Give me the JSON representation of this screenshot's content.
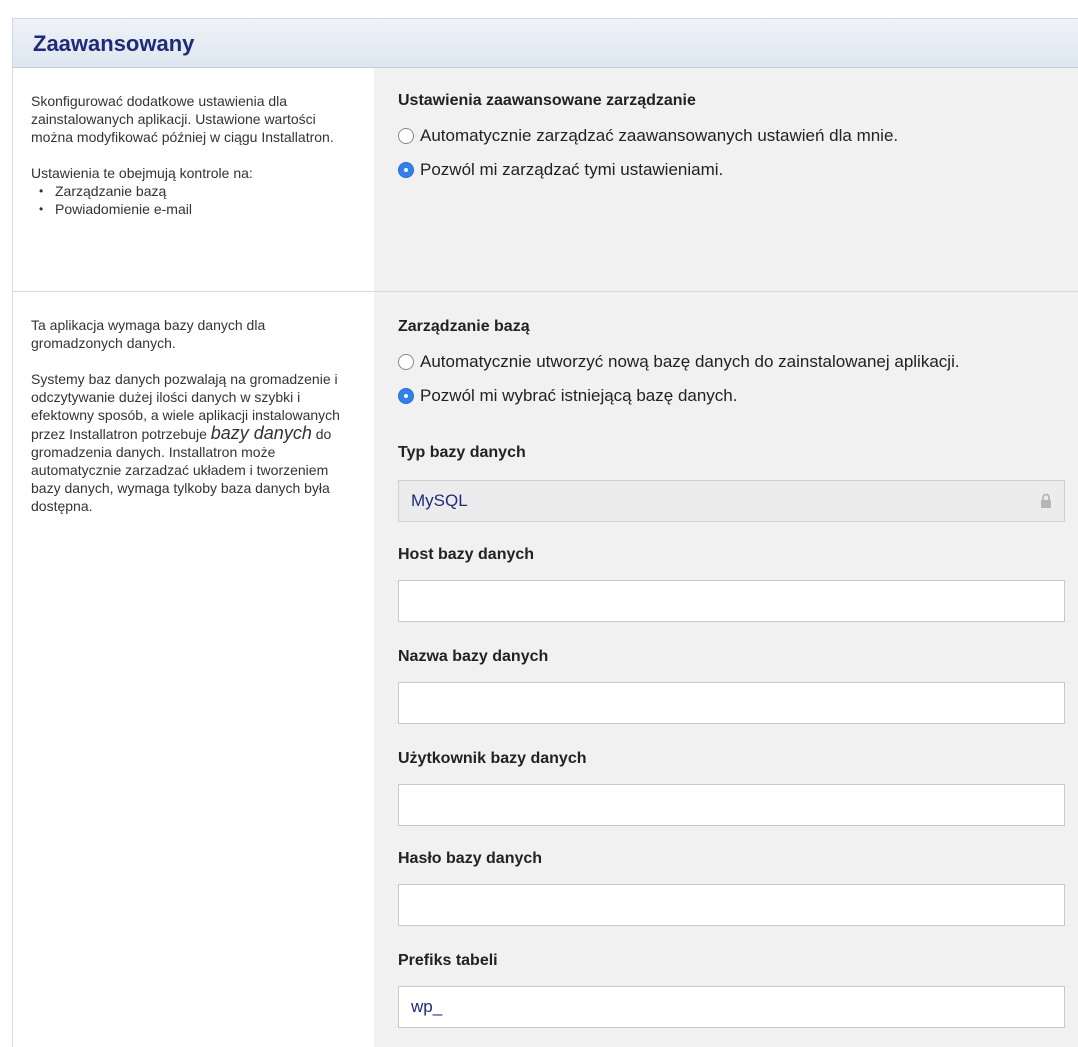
{
  "header": {
    "title": "Zaawansowany"
  },
  "section_advanced": {
    "description_1": "Skonfigurować dodatkowe ustawienia dla zainstalowanych aplikacji. Ustawione wartości można modyfikować później w ciągu Installatron.",
    "description_2": "Ustawienia te obejmują kontrole na:",
    "bullets": [
      "Zarządzanie bazą",
      "Powiadomienie e-mail"
    ],
    "title": "Ustawienia zaawansowane zarządzanie",
    "options": [
      {
        "label": "Automatycznie zarządzać zaawansowanych ustawień dla mnie.",
        "selected": false
      },
      {
        "label": "Pozwól mi zarządzać tymi ustawieniami.",
        "selected": true
      }
    ]
  },
  "section_database": {
    "description_1": "Ta aplikacja wymaga bazy danych dla gromadzonych danych.",
    "description_2_part1": "Systemy baz danych pozwalają na gromadzenie i odczytywanie dużej ilości danych w szybki i efektowny sposób, a wiele aplikacji instalowanych przez Installatron potrzebuje",
    "description_2_emph": "bazy danych",
    "description_2_part2": "do gromadzenia danych. Installatron może automatycznie zarzadzać układem i tworzeniem bazy danych, wymaga tylkoby baza danych była dostępna.",
    "title": "Zarządzanie bazą",
    "options": [
      {
        "label": "Automatycznie utworzyć nową bazę danych do zainstalowanej aplikacji.",
        "selected": false
      },
      {
        "label": "Pozwól mi wybrać istniejącą bazę danych.",
        "selected": true
      }
    ],
    "fields": {
      "db_type": {
        "label": "Typ bazy danych",
        "value": "MySQL",
        "icon": "lock-icon"
      },
      "db_host": {
        "label": "Host bazy danych",
        "value": ""
      },
      "db_name": {
        "label": "Nazwa bazy danych",
        "value": ""
      },
      "db_user": {
        "label": "Użytkownik bazy danych",
        "value": ""
      },
      "db_pass": {
        "label": "Hasło bazy danych",
        "value": ""
      },
      "table_prefix": {
        "label": "Prefiks tabeli",
        "value": "wp_"
      }
    }
  },
  "colors": {
    "title": "#1f2a7a",
    "radio_selected": "#2f80ed",
    "panel_bg": "#f1f1f1"
  }
}
